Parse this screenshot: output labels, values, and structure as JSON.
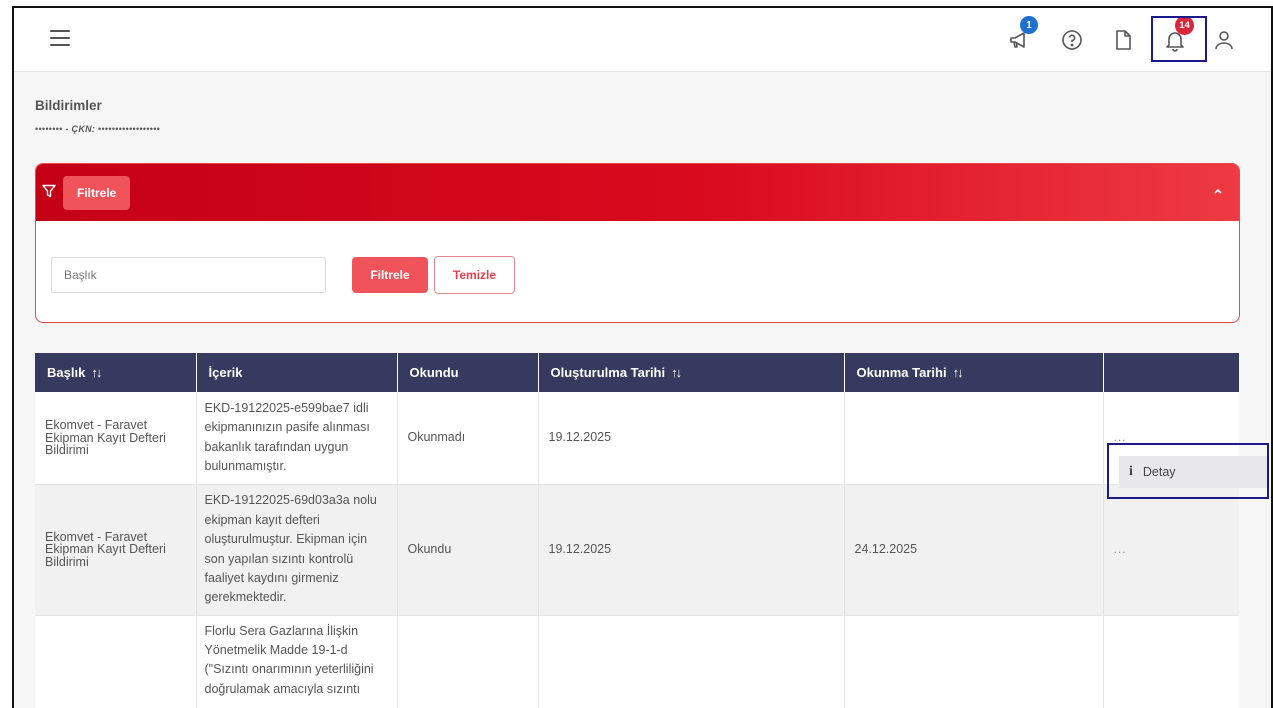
{
  "topbar": {
    "announcement_count": "1",
    "notification_count": "14"
  },
  "page": {
    "title": "Bildirimler",
    "sub_masked_name": "••••••••",
    "sub_label": "- ÇKN:",
    "sub_masked_id": "••••••••••••••••••"
  },
  "filter": {
    "header_label": "Filtrele",
    "title_placeholder": "Başlık",
    "apply_label": "Filtrele",
    "clear_label": "Temizle"
  },
  "table": {
    "columns": [
      "Başlık",
      "İçerik",
      "Okundu",
      "Oluşturulma Tarihi",
      "Okunma Tarihi",
      ""
    ],
    "rows": [
      {
        "title": "Ekomvet - Faravet Ekipman Kayıt Defteri Bildirimi",
        "content": "EKD-19122025-e599bae7 idli ekipmanınızın pasife alınması bakanlık tarafından uygun bulunmamıştır.",
        "read": "Okunmadı",
        "created": "19.12.2025",
        "read_date": "",
        "actions": "..."
      },
      {
        "title": "Ekomvet - Faravet Ekipman Kayıt Defteri Bildirimi",
        "content": "EKD-19122025-69d03a3a nolu  ekipman kayıt defteri  oluşturulmuştur. Ekipman için son yapılan sızıntı kontrolü faaliyet kaydını girmeniz gerekmektedir.",
        "read": "Okundu",
        "created": "19.12.2025",
        "read_date": "24.12.2025",
        "actions": "..."
      },
      {
        "title": "",
        "content": "Florlu Sera Gazlarına İlişkin Yönetmelik Madde 19-1-d (\"Sızıntı onarımının yeterliliğini doğrulamak amacıyla sızıntı",
        "read": "",
        "created": "",
        "read_date": "",
        "actions": ""
      }
    ]
  },
  "context_menu": {
    "detail_label": "Detay"
  },
  "colors": {
    "header_red": "#c40016",
    "button_red": "#f0545a",
    "table_header": "#363a5e",
    "highlight_box": "#1a1a8c"
  }
}
